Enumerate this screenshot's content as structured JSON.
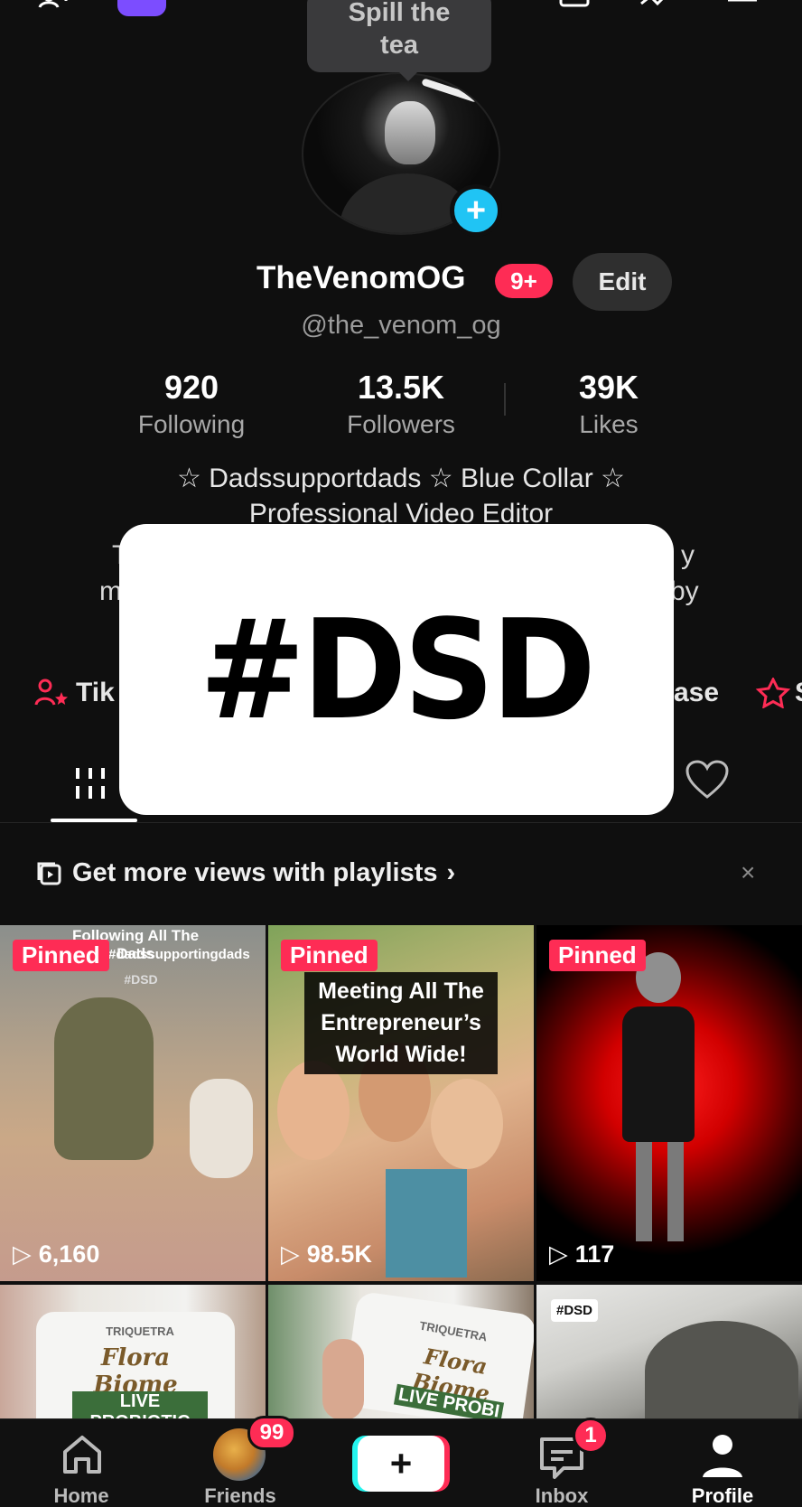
{
  "spill_tooltip": {
    "line1": "Spill the",
    "line2": "tea"
  },
  "profile": {
    "display_name": "TheVenomOG",
    "level_badge": "9+",
    "edit_label": "Edit",
    "handle": "@the_venom_og"
  },
  "stats": [
    {
      "value": "920",
      "label": "Following"
    },
    {
      "value": "13.5K",
      "label": "Followers"
    },
    {
      "value": "39K",
      "label": "Likes"
    }
  ],
  "bio": {
    "line1": "☆ Dadssupportdads ☆ Blue Collar ☆",
    "line2": "Professional Video Editor",
    "frag_left_1": "T",
    "frag_right_1": "y",
    "frag_left_2": "m",
    "frag_right_2": "by"
  },
  "links": {
    "left_label": "Tik",
    "right_label": "ase",
    "far_right_label": "S"
  },
  "overlay_text": "#DSD",
  "playlist_banner": {
    "text": "Get more views with playlists",
    "chevron": "›",
    "close": "×"
  },
  "videos": [
    {
      "pinned": "Pinned",
      "views": "6,160",
      "caption_top": "Following All The Dads",
      "caption_sub": "#dadssupportingdads",
      "tag": "#DSD"
    },
    {
      "pinned": "Pinned",
      "views": "98.5K",
      "caption": [
        "Meeting All The",
        "Entrepreneur’s",
        "World Wide!"
      ]
    },
    {
      "pinned": "Pinned",
      "views": "117"
    },
    {
      "label_top": "TRIQUETRA",
      "label_main": "Flora Biome",
      "label_sub": "LIVE PROBIOTIC"
    },
    {
      "label_top": "TRIQUETRA",
      "label_main": "Flora Biome",
      "label_sub": "LIVE PROBI"
    },
    {
      "tag": "#DSD"
    }
  ],
  "bottom_nav": {
    "home": "Home",
    "friends": "Friends",
    "friends_badge": "99",
    "inbox": "Inbox",
    "inbox_badge": "1",
    "profile": "Profile"
  },
  "colors": {
    "accent": "#fe2c55",
    "cyan": "#25f4ee",
    "background": "#0f0f0f"
  }
}
